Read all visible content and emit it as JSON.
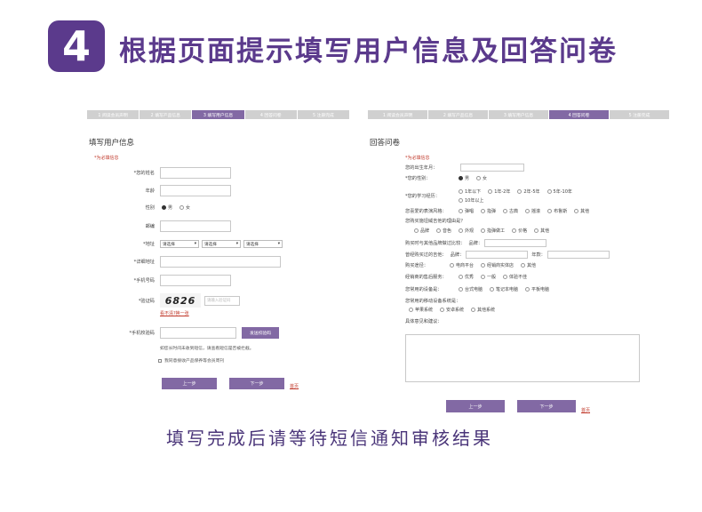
{
  "header": {
    "step_number": "4",
    "title": "根据页面提示填写用户信息及回答问卷"
  },
  "footer_caption": "填写完成后请等待短信通知审核结果",
  "left_panel": {
    "steps": [
      "1 阅读会员声明",
      "2 填写产品信息",
      "3 填写用户信息",
      "4 回答问卷",
      "5 注册完成"
    ],
    "active_step": 2,
    "heading": "填写用户信息",
    "required_note": "*为必填信息",
    "fields": {
      "name": "*您的姓名",
      "age": "年龄",
      "gender": "性别",
      "gender_male": "男",
      "gender_female": "女",
      "email": "邮编",
      "address": "*地址",
      "select_placeholder": "请选择",
      "detail_address": "*详细地址",
      "phone": "*手机号码",
      "captcha": "*验证码",
      "captcha_text": "6826",
      "captcha_input_placeholder": "请输入验证码",
      "captcha_refresh": "看不清?换一张",
      "sms_code": "*手机校验码",
      "send_code_button": "发送校验码",
      "sms_hint": "如您长时间未收到短信，请查看短信是否被拦截。",
      "agree_text": "我同意接收产品保养等会员周刊"
    },
    "buttons": {
      "prev": "上一步",
      "next": "下一步",
      "back_home": "首页"
    }
  },
  "right_panel": {
    "steps": [
      "1 阅读会员声明",
      "2 填写产品信息",
      "3 填写用户信息",
      "4 回答问卷",
      "5 注册完成"
    ],
    "active_step": 3,
    "heading": "回答问卷",
    "required_note": "*为必填信息",
    "questions": {
      "birth": "您的出生年月：",
      "gender": "*您的性别：",
      "gender_options": [
        "男",
        "女"
      ],
      "education": "*您的学习经历：",
      "education_options": [
        "1年以下",
        "1年-2年",
        "2年-5年",
        "5年-10年",
        "10年以上"
      ],
      "style": "您喜爱的表演风格：",
      "style_options": [
        "弹唱",
        "指弹",
        "古典",
        "摇滚",
        "布鲁斯",
        "其他"
      ],
      "reason": "您购买施坦威吉他的理由是？",
      "reason_options": [
        "品牌",
        "音色",
        "外观",
        "指弹做工",
        "价格",
        "其他"
      ],
      "compare": "购买时与其他品牌做过比较：",
      "compare_brand": "品牌：",
      "previous": "曾经购买过的吉他：",
      "previous_brand": "品牌：",
      "previous_year": "年款：",
      "channel": "购买途径：",
      "channel_options": [
        "电商平台",
        "经销商实体店",
        "其他"
      ],
      "dealer": "经销商的售后服务：",
      "dealer_options": [
        "优秀",
        "一般",
        "体验不佳"
      ],
      "device": "您常用的设备是：",
      "device_options": [
        "台式电脑",
        "笔记本电脑",
        "平板电脑"
      ],
      "mobile_os": "您常用的移动设备系统是：",
      "mobile_os_options": [
        "苹果系统",
        "安卓系统",
        "其他系统"
      ],
      "suggestion": "具体意见和建议："
    },
    "buttons": {
      "prev": "上一步",
      "next": "下一步",
      "back_home": "首页"
    }
  }
}
